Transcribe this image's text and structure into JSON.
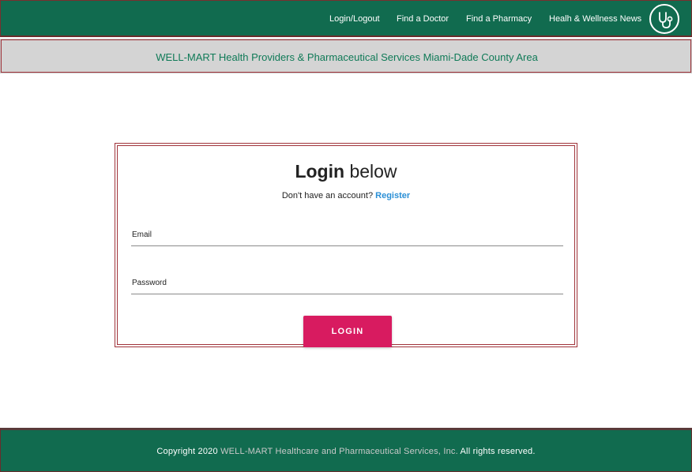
{
  "nav": {
    "items": [
      {
        "label": "Login/Logout"
      },
      {
        "label": "Find a Doctor"
      },
      {
        "label": "Find a Pharmacy"
      },
      {
        "label": "Healh & Wellness News"
      }
    ],
    "logo_icon": "stethoscope-icon"
  },
  "banner": {
    "text": "WELL-MART Health Providers & Pharmaceutical Services Miami-Dade County Area"
  },
  "login": {
    "title_bold": "Login",
    "title_rest": "below",
    "subtitle_text": "Don't have an account?",
    "register_label": "Register",
    "email_label": "Email",
    "email_value": "",
    "password_label": "Password",
    "password_value": "",
    "button_label": "LOGIN"
  },
  "footer": {
    "prefix": "Copyright 2020",
    "company": "WELL-MART Healthcare and Pharmaceutical Services, Inc.",
    "suffix": "All rights reserved."
  },
  "colors": {
    "header_bg": "#116b4f",
    "banner_bg": "#d4d4d4",
    "banner_text": "#0f7a57",
    "border_accent": "#a0333a",
    "button_bg": "#d81b60",
    "link": "#2a8fd6"
  }
}
